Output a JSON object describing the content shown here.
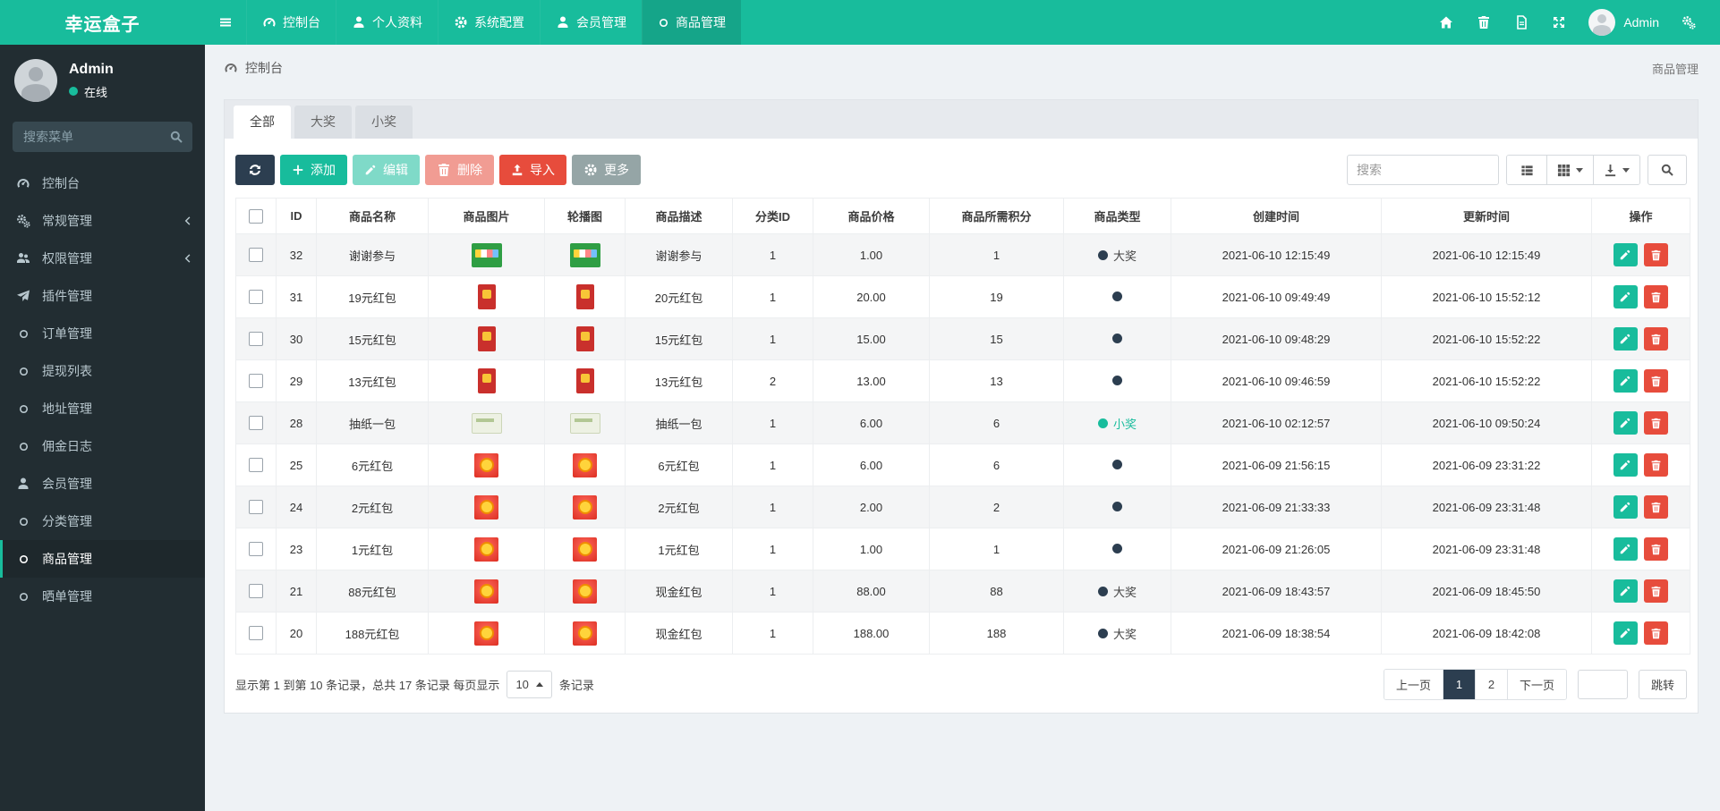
{
  "brand": "幸运盒子",
  "navbar": {
    "user_label": "Admin",
    "items": [
      {
        "id": "dashboard",
        "label": "控制台",
        "icon": "dashboard-icon",
        "active": false
      },
      {
        "id": "profile",
        "label": "个人资料",
        "icon": "user-icon",
        "active": false
      },
      {
        "id": "system-config",
        "label": "系统配置",
        "icon": "gear-icon",
        "active": false
      },
      {
        "id": "member-management",
        "label": "会员管理",
        "icon": "user-icon",
        "active": false
      },
      {
        "id": "product-management",
        "label": "商品管理",
        "icon": "circle-icon",
        "active": true
      }
    ],
    "right_buttons": [
      {
        "id": "home",
        "icon": "home-icon"
      },
      {
        "id": "clear-trash",
        "icon": "trash-icon"
      },
      {
        "id": "wipe-cache",
        "icon": "document-icon"
      },
      {
        "id": "fullscreen",
        "icon": "fullscreen-icon"
      }
    ],
    "settings_icon": "cogs-icon"
  },
  "sidebar": {
    "user": {
      "name": "Admin",
      "status": "在线"
    },
    "search_placeholder": "搜索菜单",
    "items": [
      {
        "id": "dashboard",
        "label": "控制台",
        "icon": "dashboard-icon",
        "chevron": false,
        "active": false
      },
      {
        "id": "general",
        "label": "常规管理",
        "icon": "cogs-icon",
        "chevron": true,
        "active": false
      },
      {
        "id": "permission",
        "label": "权限管理",
        "icon": "users-icon",
        "chevron": true,
        "active": false
      },
      {
        "id": "plugin",
        "label": "插件管理",
        "icon": "plugin-icon",
        "chevron": false,
        "active": false
      },
      {
        "id": "order",
        "label": "订单管理",
        "icon": "circle-icon",
        "chevron": false,
        "active": false
      },
      {
        "id": "withdraw",
        "label": "提现列表",
        "icon": "circle-icon",
        "chevron": false,
        "active": false
      },
      {
        "id": "address",
        "label": "地址管理",
        "icon": "circle-icon",
        "chevron": false,
        "active": false
      },
      {
        "id": "commission",
        "label": "佣金日志",
        "icon": "circle-icon",
        "chevron": false,
        "active": false
      },
      {
        "id": "member",
        "label": "会员管理",
        "icon": "user-icon",
        "chevron": false,
        "active": false
      },
      {
        "id": "category",
        "label": "分类管理",
        "icon": "circle-icon",
        "chevron": false,
        "active": false
      },
      {
        "id": "product",
        "label": "商品管理",
        "icon": "circle-icon",
        "chevron": false,
        "active": true
      },
      {
        "id": "review",
        "label": "晒单管理",
        "icon": "circle-icon",
        "chevron": false,
        "active": false
      }
    ]
  },
  "breadcrumb": {
    "left": "控制台",
    "right": "商品管理"
  },
  "tabs": [
    {
      "label": "全部",
      "active": true
    },
    {
      "label": "大奖",
      "active": false
    },
    {
      "label": "小奖",
      "active": false
    }
  ],
  "toolbar": {
    "refresh_icon": "refresh-icon",
    "add_label": "添加",
    "edit_label": "编辑",
    "delete_label": "删除",
    "import_label": "导入",
    "more_label": "更多",
    "search_placeholder": "搜索"
  },
  "table": {
    "columns": [
      "ID",
      "商品名称",
      "商品图片",
      "轮播图",
      "商品描述",
      "分类ID",
      "商品价格",
      "商品所需积分",
      "商品类型",
      "创建时间",
      "更新时间",
      "操作"
    ],
    "rows": [
      {
        "id": "32",
        "name": "谢谢参与",
        "image": "green-box",
        "desc": "谢谢参与",
        "category_id": "1",
        "price": "1.00",
        "points": "1",
        "type_label": "大奖",
        "type_variant": "big",
        "created_at": "2021-06-10 12:15:49",
        "updated_at": "2021-06-10 12:15:49"
      },
      {
        "id": "31",
        "name": "19元红包",
        "image": "red-envelope",
        "desc": "20元红包",
        "category_id": "1",
        "price": "20.00",
        "points": "19",
        "type_label": "",
        "type_variant": "big",
        "created_at": "2021-06-10 09:49:49",
        "updated_at": "2021-06-10 15:52:12"
      },
      {
        "id": "30",
        "name": "15元红包",
        "image": "red-envelope",
        "desc": "15元红包",
        "category_id": "1",
        "price": "15.00",
        "points": "15",
        "type_label": "",
        "type_variant": "big",
        "created_at": "2021-06-10 09:48:29",
        "updated_at": "2021-06-10 15:52:22"
      },
      {
        "id": "29",
        "name": "13元红包",
        "image": "red-envelope",
        "desc": "13元红包",
        "category_id": "2",
        "price": "13.00",
        "points": "13",
        "type_label": "",
        "type_variant": "big",
        "created_at": "2021-06-10 09:46:59",
        "updated_at": "2021-06-10 15:52:22"
      },
      {
        "id": "28",
        "name": "抽纸一包",
        "image": "tissue-pack",
        "desc": "抽纸一包",
        "category_id": "1",
        "price": "6.00",
        "points": "6",
        "type_label": "小奖",
        "type_variant": "small",
        "created_at": "2021-06-10 02:12:57",
        "updated_at": "2021-06-10 09:50:24"
      },
      {
        "id": "25",
        "name": "6元红包",
        "image": "red-gold",
        "desc": "6元红包",
        "category_id": "1",
        "price": "6.00",
        "points": "6",
        "type_label": "",
        "type_variant": "big",
        "created_at": "2021-06-09 21:56:15",
        "updated_at": "2021-06-09 23:31:22"
      },
      {
        "id": "24",
        "name": "2元红包",
        "image": "red-gold",
        "desc": "2元红包",
        "category_id": "1",
        "price": "2.00",
        "points": "2",
        "type_label": "",
        "type_variant": "big",
        "created_at": "2021-06-09 21:33:33",
        "updated_at": "2021-06-09 23:31:48"
      },
      {
        "id": "23",
        "name": "1元红包",
        "image": "red-gold",
        "desc": "1元红包",
        "category_id": "1",
        "price": "1.00",
        "points": "1",
        "type_label": "",
        "type_variant": "big",
        "created_at": "2021-06-09 21:26:05",
        "updated_at": "2021-06-09 23:31:48"
      },
      {
        "id": "21",
        "name": "88元红包",
        "image": "red-gold",
        "desc": "现金红包",
        "category_id": "1",
        "price": "88.00",
        "points": "88",
        "type_label": "大奖",
        "type_variant": "big",
        "created_at": "2021-06-09 18:43:57",
        "updated_at": "2021-06-09 18:45:50"
      },
      {
        "id": "20",
        "name": "188元红包",
        "image": "red-gold",
        "desc": "现金红包",
        "category_id": "1",
        "price": "188.00",
        "points": "188",
        "type_label": "大奖",
        "type_variant": "big",
        "created_at": "2021-06-09 18:38:54",
        "updated_at": "2021-06-09 18:42:08"
      }
    ]
  },
  "pagination": {
    "summary_prefix": "显示第 1 到第 10 条记录，总共 17 条记录 每页显示",
    "page_size": "10",
    "summary_suffix": "条记录",
    "prev_label": "上一页",
    "pages": [
      "1",
      "2"
    ],
    "active_page": "1",
    "next_label": "下一页",
    "jump_label": "跳转"
  },
  "colors": {
    "accent": "#18bc9c",
    "dark": "#2c3e50",
    "danger": "#e74c3c",
    "sidebar_bg": "#222d32",
    "type_big_dot": "#2c3e50",
    "type_small_dot": "#18bc9c"
  }
}
